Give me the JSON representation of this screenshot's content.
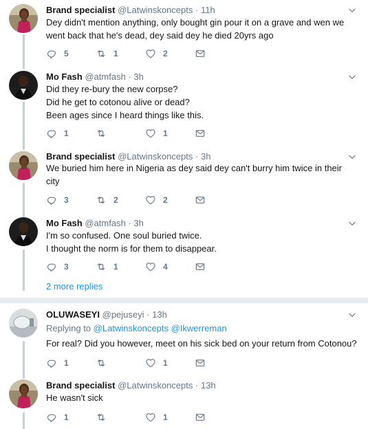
{
  "tweets": [
    {
      "name": "Brand specialist",
      "handle": "@Latwinskoncepts",
      "time": "11h",
      "text": "Dey didn't mention anything, only bought gin pour it on a grave and wen we went back that he's dead, dey said dey he died 20yrs ago",
      "replies": "5",
      "retweets": "1",
      "likes": "2",
      "avatar": "brand-specialist"
    },
    {
      "name": "Mo Fash",
      "handle": "@atmfash",
      "time": "3h",
      "text_lines": [
        "Did they re-bury the new corpse?",
        "Did he get to cotonou alive or dead?",
        "Been ages since I heard things like this."
      ],
      "replies": "1",
      "retweets": "",
      "likes": "1",
      "avatar": "mo-fash"
    },
    {
      "name": "Brand specialist",
      "handle": "@Latwinskoncepts",
      "time": "3h",
      "text": "We buried him here in Nigeria as dey said dey can't burry him twice in their city",
      "replies": "3",
      "retweets": "2",
      "likes": "2",
      "avatar": "brand-specialist"
    },
    {
      "name": "Mo Fash",
      "handle": "@atmfash",
      "time": "3h",
      "text_lines": [
        "I'm so confused. One soul buried twice.",
        "I thought the norm is for them to disappear."
      ],
      "replies": "3",
      "retweets": "1",
      "likes": "4",
      "avatar": "mo-fash"
    },
    {
      "name": "OLUWASEYI",
      "handle": "@pejuseyi",
      "time": "13h",
      "replying_to_label": "Replying to",
      "replying_to": [
        "@Latwinskoncepts",
        "@Ikwerreman"
      ],
      "text": "For real? Did you however, meet on his sick bed on your return from Cotonou?",
      "replies": "1",
      "retweets": "",
      "likes": "1",
      "avatar": "oluwaseyi"
    },
    {
      "name": "Brand specialist",
      "handle": "@Latwinskoncepts",
      "time": "13h",
      "text": "He wasn't sick",
      "replies": "1",
      "retweets": "",
      "likes": "1",
      "avatar": "brand-specialist"
    }
  ],
  "more_replies": "2 more replies",
  "dot": "·",
  "colors": {
    "accent": "#1b95e0",
    "muted": "#657786",
    "thread_line": "#c4cfd6",
    "divider": "#e6ecf0"
  },
  "icons": {
    "reply": "reply-icon",
    "retweet": "retweet-icon",
    "like": "heart-icon",
    "message": "envelope-icon",
    "menu": "chevron-down-icon"
  }
}
